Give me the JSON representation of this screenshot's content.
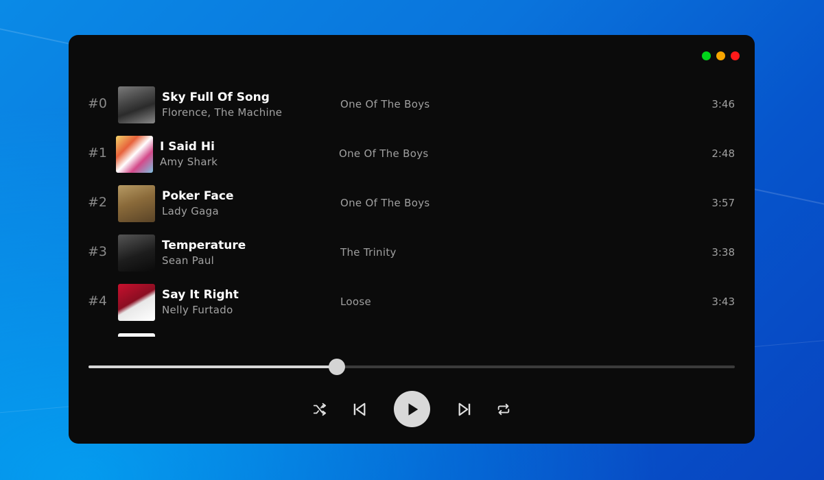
{
  "window": {
    "controls": {
      "green": "#00d41a",
      "yellow": "#f6a500",
      "red": "#ff1a1a"
    }
  },
  "tracks": [
    {
      "number": "#0",
      "title": "Sky Full Of Song",
      "artist": "Florence, The Machine",
      "album": "One Of The Boys",
      "duration": "3:46"
    },
    {
      "number": "#1",
      "title": "I Said Hi",
      "artist": "Amy Shark",
      "album": "One Of The Boys",
      "duration": "2:48"
    },
    {
      "number": "#2",
      "title": "Poker Face",
      "artist": "Lady Gaga",
      "album": "One Of The Boys",
      "duration": "3:57"
    },
    {
      "number": "#3",
      "title": "Temperature",
      "artist": "Sean Paul",
      "album": "The Trinity",
      "duration": "3:38"
    },
    {
      "number": "#4",
      "title": "Say It Right",
      "artist": "Nelly Furtado",
      "album": "Loose",
      "duration": "3:43"
    }
  ],
  "player": {
    "progress": 0.384,
    "icons": [
      "shuffle-icon",
      "skip-previous-icon",
      "play-icon",
      "skip-next-icon",
      "repeat-icon"
    ]
  },
  "colors": {
    "window_bg": "#0b0b0b",
    "accent": "#d9d9d9",
    "desktop": "#0a74dc"
  }
}
